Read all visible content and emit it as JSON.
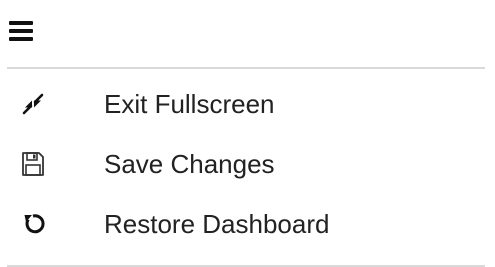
{
  "header": {
    "menu_icon": "hamburger-icon"
  },
  "menu": {
    "items": [
      {
        "label": "Exit Fullscreen",
        "icon": "exit-fullscreen-icon"
      },
      {
        "label": "Save Changes",
        "icon": "save-icon"
      },
      {
        "label": "Restore Dashboard",
        "icon": "restore-icon"
      }
    ]
  },
  "colors": {
    "text": "#222222",
    "icon": "#111111",
    "divider": "#d9d9d9"
  }
}
